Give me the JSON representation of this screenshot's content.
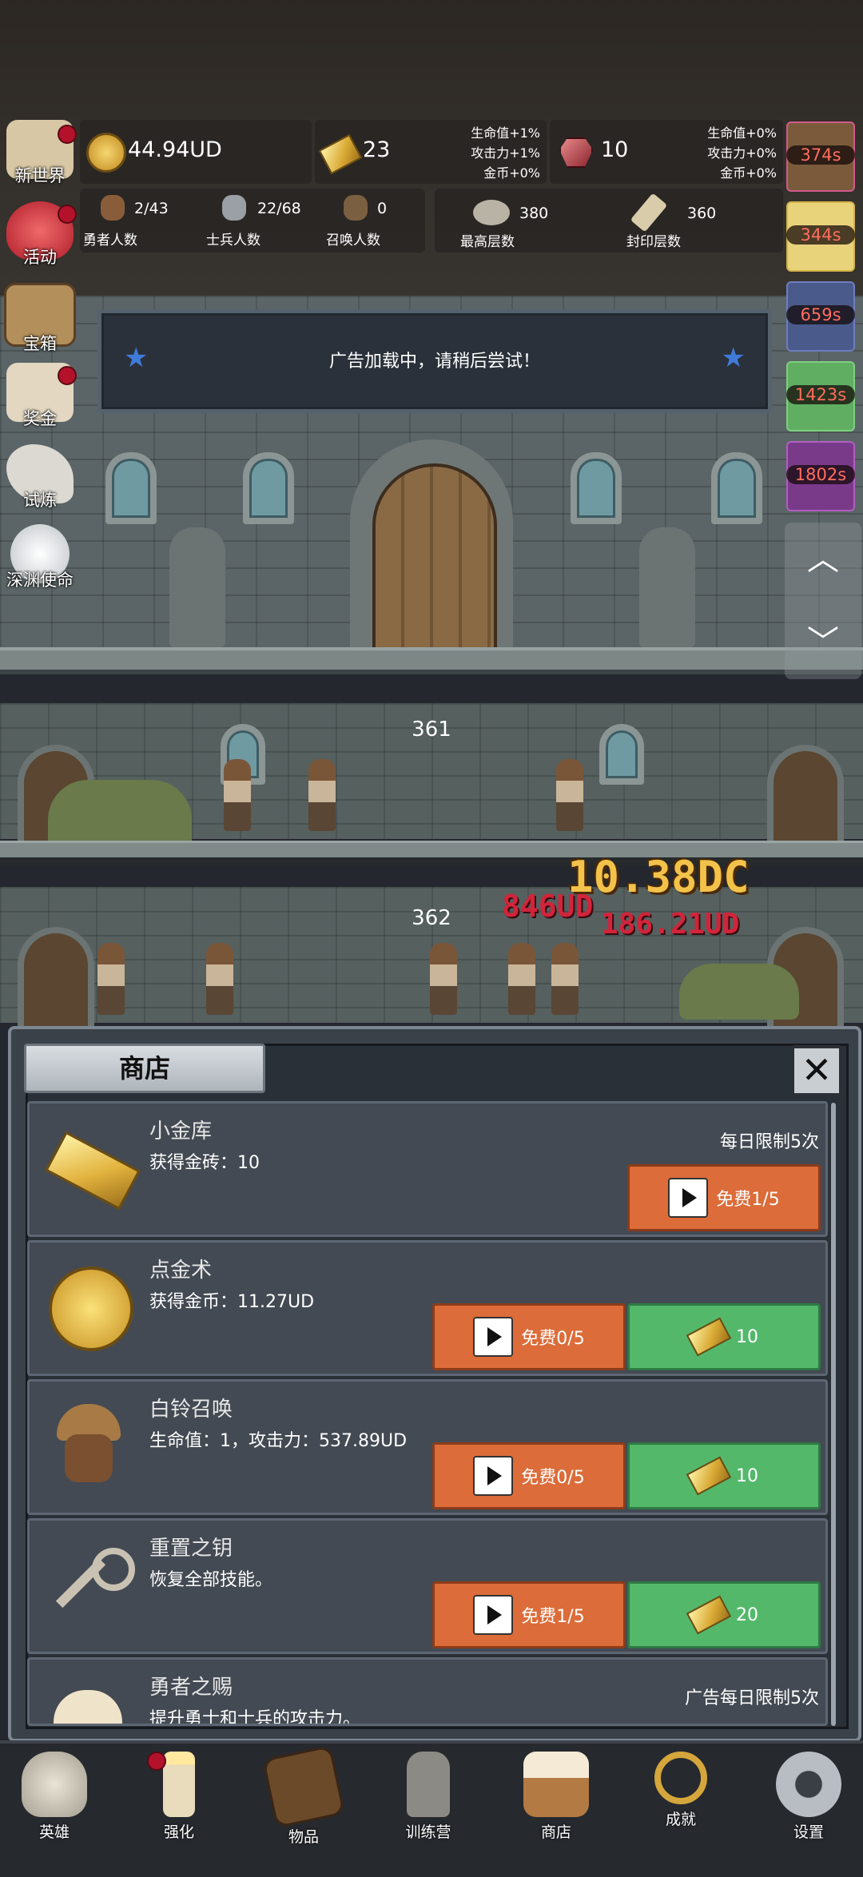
{
  "top_left": {
    "gold_coin": "44.94UD",
    "gold_bar": {
      "value": "23",
      "hp": "生命值+1%",
      "atk": "攻击力+1%",
      "gold": "金币+0%"
    },
    "gem": {
      "value": "10",
      "hp": "生命值+0%",
      "atk": "攻击力+0%",
      "gold": "金币+0%"
    },
    "heroes": {
      "value": "2/43",
      "label": "勇者人数"
    },
    "soldiers": {
      "value": "22/68",
      "label": "士兵人数"
    },
    "summons": {
      "value": "0",
      "label": "召唤人数"
    },
    "max_floor": {
      "value": "380",
      "label": "最高层数"
    },
    "sealed_floor": {
      "value": "360",
      "label": "封印层数"
    }
  },
  "left_menu": [
    {
      "label": "新世界",
      "icon": "map-icon",
      "dot": true
    },
    {
      "label": "活动",
      "icon": "heart-icon",
      "dot": true
    },
    {
      "label": "宝箱",
      "icon": "chest-icon",
      "dot": false
    },
    {
      "label": "奖金",
      "icon": "envelope-icon",
      "dot": true
    },
    {
      "label": "试炼",
      "icon": "quill-icon",
      "dot": false
    },
    {
      "label": "深渊使命",
      "icon": "pearl-icon",
      "dot": false
    }
  ],
  "right_timers": [
    "374s",
    "344s",
    "659s",
    "1423s",
    "1802s"
  ],
  "notice": "广告加载中，请稍后尝试！",
  "floors": {
    "upper": "361",
    "lower": "362"
  },
  "damage": {
    "big": "10.38DC",
    "red1": "846UD",
    "red2": "186.21UD"
  },
  "shop": {
    "title": "商店",
    "close": "✕",
    "items": [
      {
        "name": "小金库",
        "desc": "获得金砖：10",
        "limit": "每日限制5次",
        "free": "免费1/5",
        "icon": "gold-bar-icon"
      },
      {
        "name": "点金术",
        "desc": "获得金币：11.27UD",
        "free": "免费0/5",
        "price": "10",
        "icon": "gold-coin-icon"
      },
      {
        "name": "白铃召唤",
        "desc": "生命值：1，攻击力：537.89UD",
        "free": "免费0/5",
        "price": "10",
        "icon": "hero-girl-icon"
      },
      {
        "name": "重置之钥",
        "desc": "恢复全部技能。",
        "free": "免费1/5",
        "price": "20",
        "icon": "key-icon"
      },
      {
        "name": "勇者之赐",
        "desc": "提升勇士和士兵的攻击力。",
        "limit": "广告每日限制5次",
        "icon": "tankard-icon"
      }
    ]
  },
  "bottom_nav": [
    {
      "label": "英雄",
      "icon": "skull-icon",
      "dot": false
    },
    {
      "label": "强化",
      "icon": "candle-icon",
      "dot": true
    },
    {
      "label": "物品",
      "icon": "book-icon",
      "dot": false
    },
    {
      "label": "训练营",
      "icon": "lantern-icon",
      "dot": false
    },
    {
      "label": "商店",
      "icon": "tankard-icon",
      "dot": false
    },
    {
      "label": "成就",
      "icon": "key-icon",
      "dot": false
    },
    {
      "label": "设置",
      "icon": "gear-icon",
      "dot": false
    }
  ],
  "colors": {
    "orange_button": "#dc6c39",
    "green_button": "#54b86b",
    "timer_text": "#ff6d5e",
    "damage_gold": "#f3c24a",
    "damage_red": "#d2243a"
  }
}
